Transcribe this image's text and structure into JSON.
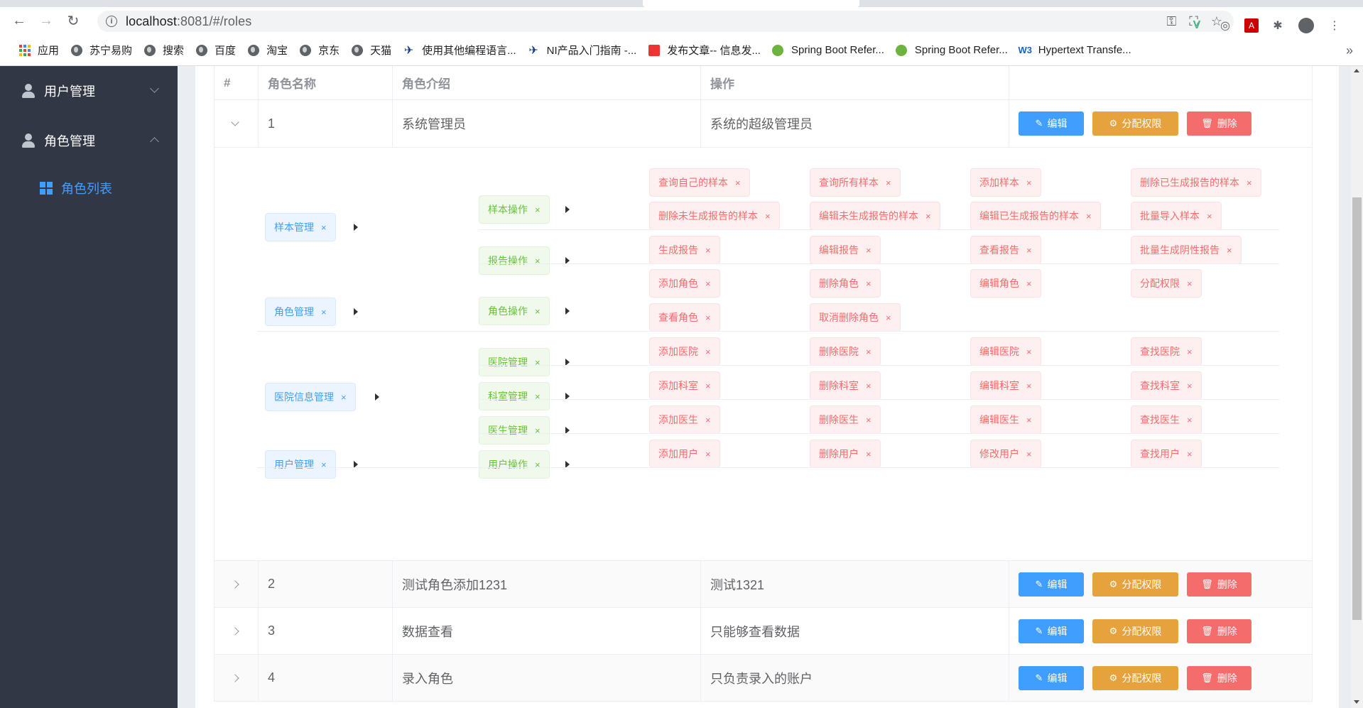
{
  "browser": {
    "url_host": "localhost",
    "url_path": ":8081/#/roles",
    "bookmarks": [
      {
        "label": "应用",
        "icon": "apps-icon"
      },
      {
        "label": "苏宁易购",
        "icon": "globe-icon"
      },
      {
        "label": "搜索",
        "icon": "globe-icon"
      },
      {
        "label": "百度",
        "icon": "globe-icon"
      },
      {
        "label": "淘宝",
        "icon": "globe-icon"
      },
      {
        "label": "京东",
        "icon": "globe-icon"
      },
      {
        "label": "天猫",
        "icon": "globe-icon"
      },
      {
        "label": "使用其他编程语言...",
        "icon": "ni-logo-icon"
      },
      {
        "label": "NI产品入门指南 -...",
        "icon": "ni-logo-icon"
      },
      {
        "label": "发布文章-- 信息发...",
        "icon": "csdn-icon"
      },
      {
        "label": "Spring Boot Refer...",
        "icon": "spring-icon"
      },
      {
        "label": "Spring Boot Refer...",
        "icon": "spring-icon"
      },
      {
        "label": "Hypertext Transfe...",
        "icon": "w3-icon"
      }
    ],
    "more": "»"
  },
  "sidebar": {
    "menus": [
      {
        "label": "用户管理",
        "expanded": false
      },
      {
        "label": "角色管理",
        "expanded": true
      }
    ],
    "active_item": "角色列表"
  },
  "table": {
    "headers": [
      "#",
      "角色名称",
      "角色介绍",
      "操作"
    ],
    "rows": [
      {
        "index": "1",
        "name": "系统管理员",
        "desc": "系统的超级管理员"
      },
      {
        "index": "2",
        "name": "测试角色添加1231",
        "desc": "测试1321"
      },
      {
        "index": "3",
        "name": "数据查看",
        "desc": "只能够查看数据"
      },
      {
        "index": "4",
        "name": "录入角色",
        "desc": "只负责录入的账户"
      }
    ],
    "buttons": {
      "edit": "编辑",
      "assign": "分配权限",
      "delete": "删除"
    }
  },
  "rights": {
    "level1": [
      "样本管理",
      "角色管理",
      "医院信息管理",
      "用户管理"
    ],
    "level2": [
      "样本操作",
      "报告操作",
      "角色操作",
      "医院管理",
      "科室管理",
      "医生管理",
      "用户操作"
    ],
    "level3": [
      [
        "查询自己的样本",
        "查询所有样本",
        "添加样本",
        "删除已生成报告的样本",
        "删除未生成报告的样本",
        "编辑未生成报告的样本",
        "编辑已生成报告的样本",
        "批量导入样本"
      ],
      [
        "生成报告",
        "编辑报告",
        "查看报告",
        "批量生成阴性报告"
      ],
      [
        "添加角色",
        "删除角色",
        "编辑角色",
        "分配权限",
        "查看角色",
        "取消删除角色"
      ],
      [
        "添加医院",
        "删除医院",
        "编辑医院",
        "查找医院"
      ],
      [
        "添加科室",
        "删除科室",
        "编辑科室",
        "查找科室"
      ],
      [
        "添加医生",
        "删除医生",
        "编辑医生",
        "查找医生"
      ],
      [
        "添加用户",
        "删除用户",
        "修改用户",
        "查找用户"
      ]
    ],
    "close_glyph": "×"
  },
  "colors": {
    "primary": "#409eff",
    "warning": "#e6a23c",
    "danger": "#f56c6c",
    "success": "#67c23a",
    "sidebar": "#323745"
  }
}
